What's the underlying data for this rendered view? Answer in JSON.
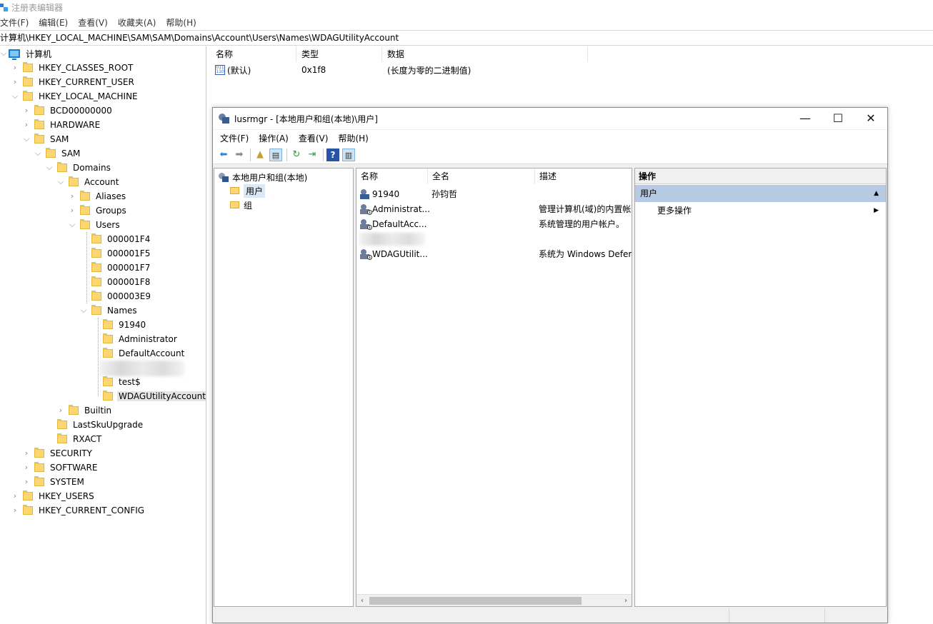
{
  "regedit": {
    "title": "注册表编辑器",
    "menu": [
      "文件(F)",
      "编辑(E)",
      "查看(V)",
      "收藏夹(A)",
      "帮助(H)"
    ],
    "address": "计算机\\HKEY_LOCAL_MACHINE\\SAM\\SAM\\Domains\\Account\\Users\\Names\\WDAGUtilityAccount",
    "tree": {
      "root": "计算机",
      "hkcr": "HKEY_CLASSES_ROOT",
      "hkcu": "HKEY_CURRENT_USER",
      "hklm": "HKEY_LOCAL_MACHINE",
      "bcd": "BCD00000000",
      "hardware": "HARDWARE",
      "sam": "SAM",
      "sam2": "SAM",
      "domains": "Domains",
      "account": "Account",
      "aliases": "Aliases",
      "groups": "Groups",
      "users": "Users",
      "u1": "000001F4",
      "u2": "000001F5",
      "u3": "000001F7",
      "u4": "000001F8",
      "u5": "000003E9",
      "names": "Names",
      "n1": "91940",
      "n2": "Administrator",
      "n3": "DefaultAccount",
      "n5": "test$",
      "n6": "WDAGUtilityAccount",
      "builtin": "Builtin",
      "lastsku": "LastSkuUpgrade",
      "rxact": "RXACT",
      "security": "SECURITY",
      "software": "SOFTWARE",
      "system": "SYSTEM",
      "hku": "HKEY_USERS",
      "hkcc": "HKEY_CURRENT_CONFIG"
    },
    "values": {
      "headers": [
        "名称",
        "类型",
        "数据"
      ],
      "row": {
        "name": "(默认)",
        "type": "0x1f8",
        "data": "(长度为零的二进制值)"
      }
    }
  },
  "lusrmgr": {
    "title": "lusrmgr - [本地用户和组(本地)\\用户]",
    "menu": [
      "文件(F)",
      "操作(A)",
      "查看(V)",
      "帮助(H)"
    ],
    "tree": {
      "root": "本地用户和组(本地)",
      "users": "用户",
      "groups": "组"
    },
    "list": {
      "headers": [
        "名称",
        "全名",
        "描述"
      ],
      "rows": [
        {
          "name": "91940",
          "fullname": "孙钧哲",
          "desc": ""
        },
        {
          "name": "Administrat...",
          "fullname": "",
          "desc": "管理计算机(域)的内置帐"
        },
        {
          "name": "DefaultAcc...",
          "fullname": "",
          "desc": "系统管理的用户帐户。"
        },
        {
          "name": "WDAGUtilit...",
          "fullname": "",
          "desc": "系统为 Windows Defer"
        }
      ]
    },
    "actions": {
      "header": "操作",
      "section": "用户",
      "more": "更多操作"
    }
  }
}
